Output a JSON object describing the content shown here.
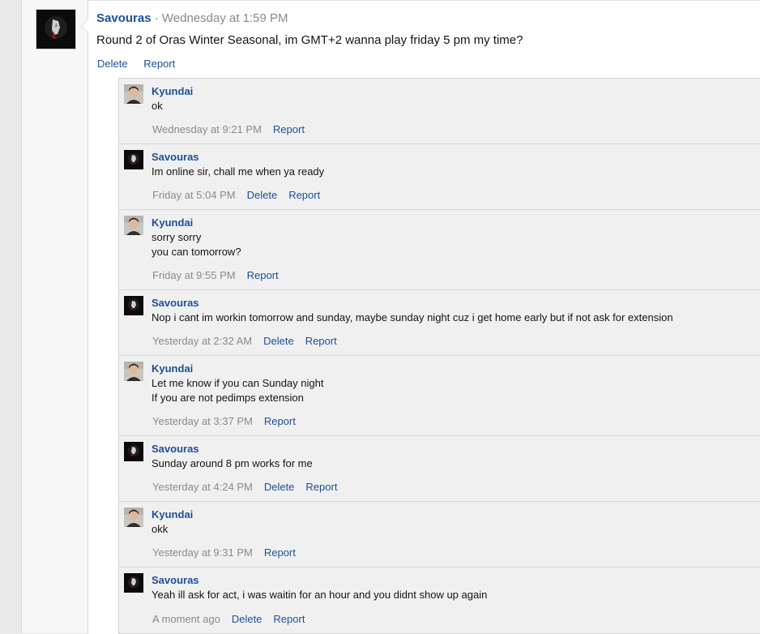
{
  "post": {
    "author": "Savouras",
    "separator": "·",
    "time": "Wednesday at 1:59 PM",
    "text": "Round 2 of Oras Winter Seasonal, im GMT+2 wanna play friday 5 pm my time?",
    "actions": {
      "delete": "Delete",
      "report": "Report"
    }
  },
  "comments": [
    {
      "author": "Kyundai",
      "avatar": "photo-avatar",
      "lines": [
        "ok"
      ],
      "time": "Wednesday at 9:21 PM",
      "actions": [
        "Report"
      ]
    },
    {
      "author": "Savouras",
      "avatar": "dark-avatar",
      "lines": [
        "Im online sir, chall me when ya ready"
      ],
      "time": "Friday at 5:04 PM",
      "actions": [
        "Delete",
        "Report"
      ]
    },
    {
      "author": "Kyundai",
      "avatar": "photo-avatar",
      "lines": [
        "sorry sorry",
        "you can tomorrow?"
      ],
      "time": "Friday at 9:55 PM",
      "actions": [
        "Report"
      ]
    },
    {
      "author": "Savouras",
      "avatar": "dark-avatar",
      "lines": [
        "Nop i cant im workin tomorrow and sunday, maybe sunday night cuz i get home early but if not ask for extension"
      ],
      "time": "Yesterday at 2:32 AM",
      "actions": [
        "Delete",
        "Report"
      ]
    },
    {
      "author": "Kyundai",
      "avatar": "photo-avatar",
      "lines": [
        "Let me know if you can Sunday night",
        "If you are not pedimps extension"
      ],
      "time": "Yesterday at 3:37 PM",
      "actions": [
        "Report"
      ]
    },
    {
      "author": "Savouras",
      "avatar": "dark-avatar",
      "lines": [
        "Sunday around 8 pm works for me"
      ],
      "time": "Yesterday at 4:24 PM",
      "actions": [
        "Delete",
        "Report"
      ]
    },
    {
      "author": "Kyundai",
      "avatar": "photo-avatar",
      "lines": [
        "okk"
      ],
      "time": "Yesterday at 9:31 PM",
      "actions": [
        "Report"
      ]
    },
    {
      "author": "Savouras",
      "avatar": "dark-avatar",
      "lines": [
        "Yeah ill ask for act, i was waitin for an hour and you didnt show up again"
      ],
      "time": "A moment ago",
      "actions": [
        "Delete",
        "Report"
      ]
    }
  ],
  "colors": {
    "link": "#1b4f9c",
    "muted": "#8a8a8a",
    "text": "#141414"
  }
}
